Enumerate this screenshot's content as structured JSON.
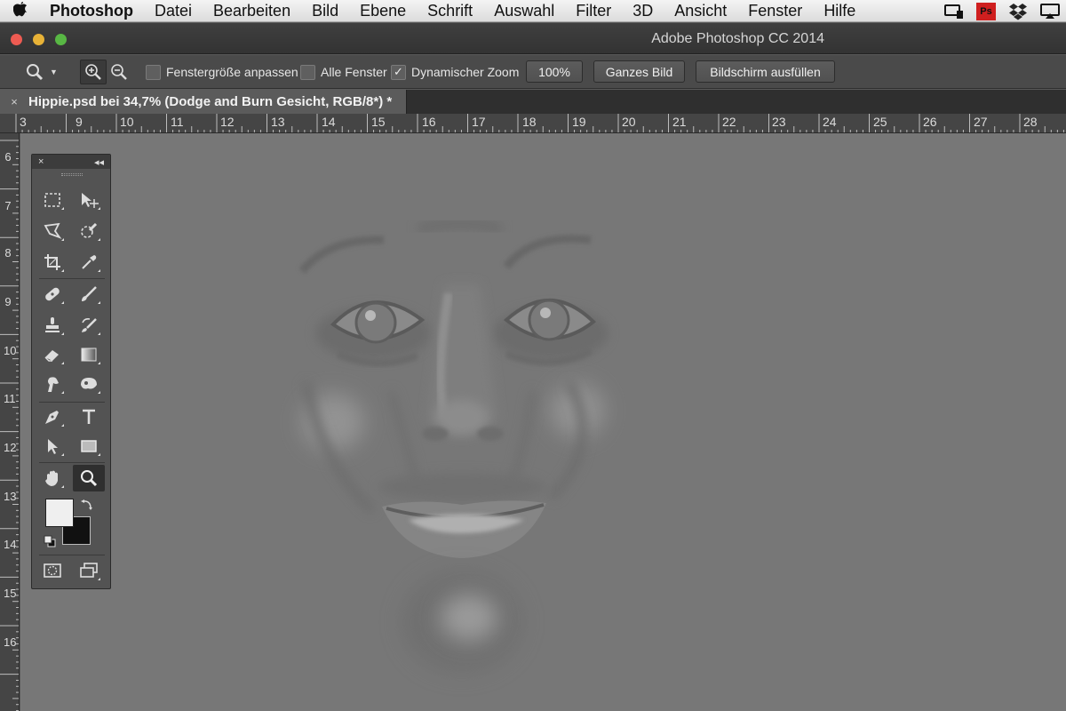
{
  "menubar": {
    "app_name": "Photoshop",
    "items": [
      "Datei",
      "Bearbeiten",
      "Bild",
      "Ebene",
      "Schrift",
      "Auswahl",
      "Filter",
      "3D",
      "Ansicht",
      "Fenster",
      "Hilfe"
    ],
    "tray_icons": [
      "display-icon",
      "app-badge-icon",
      "dropbox-icon",
      "airplay-icon"
    ],
    "tray_badge_text": "Ps"
  },
  "window": {
    "title": "Adobe Photoshop CC 2014"
  },
  "options": {
    "resize_windows_label": "Fenstergröße anpassen",
    "all_windows_label": "Alle Fenster",
    "scrubby_zoom_label": "Dynamischer Zoom",
    "scrubby_zoom_checked": true,
    "zoom_100_label": "100%",
    "fit_screen_label": "Ganzes Bild",
    "fill_screen_label": "Bildschirm ausfüllen"
  },
  "document": {
    "tab_title": "Hippie.psd bei 34,7% (Dodge and Burn Gesicht, RGB/8*) *",
    "close_symbol": "×"
  },
  "rulers": {
    "horizontal": [
      "3",
      "9",
      "10",
      "11",
      "12",
      "13",
      "14",
      "15",
      "16",
      "17",
      "18",
      "19",
      "20",
      "21",
      "22",
      "23",
      "24",
      "25",
      "26",
      "27",
      "28"
    ],
    "vertical": [
      "6",
      "7",
      "8",
      "9",
      "10",
      "11",
      "12",
      "13",
      "14",
      "15",
      "16"
    ]
  },
  "tools_panel": {
    "close_symbol": "×",
    "collapse_symbol": "◂◂",
    "tools": [
      "rectangular-marquee",
      "move",
      "polygonal-lasso",
      "quick-selection",
      "crop",
      "eyedropper",
      "spot-healing-brush",
      "brush",
      "clone-stamp",
      "history-brush",
      "eraser",
      "gradient",
      "smudge",
      "dodge",
      "pen",
      "type",
      "path-selection",
      "rectangle",
      "hand",
      "zoom",
      "quick-mask",
      "screen-mode"
    ],
    "active_tool": "zoom",
    "foreground_color": "#efefef",
    "background_color": "#111111"
  }
}
